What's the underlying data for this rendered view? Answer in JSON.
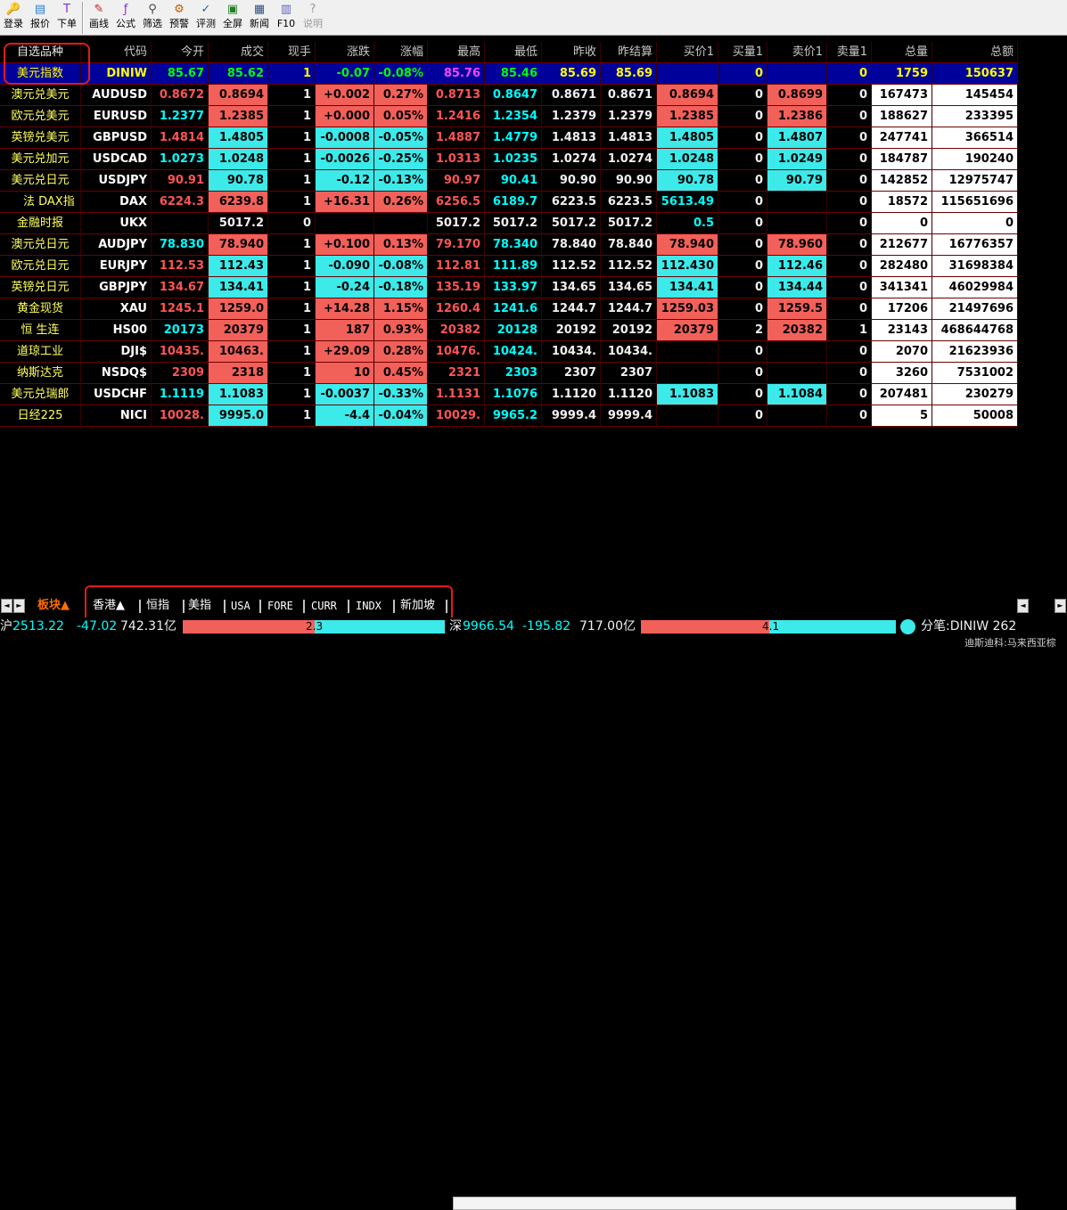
{
  "toolbar": {
    "items": [
      {
        "label": "登录",
        "icon": "login-icon",
        "glyph": "🔑"
      },
      {
        "label": "报价",
        "icon": "quote-icon",
        "glyph": "▤"
      },
      {
        "label": "下单",
        "icon": "order-icon",
        "glyph": "T"
      },
      {
        "label": "画线",
        "icon": "draw-line-icon",
        "glyph": "✎"
      },
      {
        "label": "公式",
        "icon": "formula-icon",
        "glyph": "ƒ"
      },
      {
        "label": "筛选",
        "icon": "filter-icon",
        "glyph": "⚲"
      },
      {
        "label": "预警",
        "icon": "alert-icon",
        "glyph": "⚙"
      },
      {
        "label": "评测",
        "icon": "evaluate-icon",
        "glyph": "✓"
      },
      {
        "label": "全屏",
        "icon": "fullscreen-icon",
        "glyph": "▣"
      },
      {
        "label": "新闻",
        "icon": "news-icon",
        "glyph": "▦"
      },
      {
        "label": "F10",
        "icon": "f10-icon",
        "glyph": "▥"
      },
      {
        "label": "说明",
        "icon": "help-icon",
        "glyph": "?"
      }
    ]
  },
  "table": {
    "headers": [
      "自选品种",
      "代码",
      "今开",
      "成交",
      "现手",
      "涨跌",
      "涨幅",
      "最高",
      "最低",
      "昨收",
      "昨结算",
      "买价1",
      "买量1",
      "卖价1",
      "卖量1",
      "总量",
      "总额"
    ],
    "rows": [
      {
        "name": "美元指数",
        "code": "DINIW",
        "open": "85.67",
        "last": "85.62",
        "vol_now": "1",
        "change": "-0.07",
        "pct": "-0.08%",
        "high": "85.76",
        "low": "85.46",
        "prev_close": "85.69",
        "prev_settle": "85.69",
        "bid": "",
        "bid_vol": "0",
        "ask": "",
        "ask_vol": "0",
        "total_vol": "1759",
        "amount": "150637"
      },
      {
        "name": "澳元兑美元",
        "code": "AUDUSD",
        "open": "0.8672",
        "last": "0.8694",
        "vol_now": "1",
        "change": "+0.002",
        "pct": "0.27%",
        "high": "0.8713",
        "low": "0.8647",
        "prev_close": "0.8671",
        "prev_settle": "0.8671",
        "bid": "0.8694",
        "bid_vol": "0",
        "ask": "0.8699",
        "ask_vol": "0",
        "total_vol": "167473",
        "amount": "145454"
      },
      {
        "name": "欧元兑美元",
        "code": "EURUSD",
        "open": "1.2377",
        "last": "1.2385",
        "vol_now": "1",
        "change": "+0.000",
        "pct": "0.05%",
        "high": "1.2416",
        "low": "1.2354",
        "prev_close": "1.2379",
        "prev_settle": "1.2379",
        "bid": "1.2385",
        "bid_vol": "0",
        "ask": "1.2386",
        "ask_vol": "0",
        "total_vol": "188627",
        "amount": "233395"
      },
      {
        "name": "英镑兑美元",
        "code": "GBPUSD",
        "open": "1.4814",
        "last": "1.4805",
        "vol_now": "1",
        "change": "-0.0008",
        "pct": "-0.05%",
        "high": "1.4887",
        "low": "1.4779",
        "prev_close": "1.4813",
        "prev_settle": "1.4813",
        "bid": "1.4805",
        "bid_vol": "0",
        "ask": "1.4807",
        "ask_vol": "0",
        "total_vol": "247741",
        "amount": "366514"
      },
      {
        "name": "美元兑加元",
        "code": "USDCAD",
        "open": "1.0273",
        "last": "1.0248",
        "vol_now": "1",
        "change": "-0.0026",
        "pct": "-0.25%",
        "high": "1.0313",
        "low": "1.0235",
        "prev_close": "1.0274",
        "prev_settle": "1.0274",
        "bid": "1.0248",
        "bid_vol": "0",
        "ask": "1.0249",
        "ask_vol": "0",
        "total_vol": "184787",
        "amount": "190240"
      },
      {
        "name": "美元兑日元",
        "code": "USDJPY",
        "open": "90.91",
        "last": "90.78",
        "vol_now": "1",
        "change": "-0.12",
        "pct": "-0.13%",
        "high": "90.97",
        "low": "90.41",
        "prev_close": "90.90",
        "prev_settle": "90.90",
        "bid": "90.78",
        "bid_vol": "0",
        "ask": "90.79",
        "ask_vol": "0",
        "total_vol": "142852",
        "amount": "12975747"
      },
      {
        "name": "法 DAX指",
        "code": "DAX",
        "open": "6224.3",
        "last": "6239.8",
        "vol_now": "1",
        "change": "+16.31",
        "pct": "0.26%",
        "high": "6256.5",
        "low": "6189.7",
        "prev_close": "6223.5",
        "prev_settle": "6223.5",
        "bid": "5613.49",
        "bid_vol": "0",
        "ask": "",
        "ask_vol": "0",
        "total_vol": "18572",
        "amount": "115651696"
      },
      {
        "name": "金融时报",
        "code": "UKX",
        "open": "",
        "last": "5017.2",
        "vol_now": "0",
        "change": "",
        "pct": "",
        "high": "5017.2",
        "low": "5017.2",
        "prev_close": "5017.2",
        "prev_settle": "5017.2",
        "bid": "0.5",
        "bid_vol": "0",
        "ask": "",
        "ask_vol": "0",
        "total_vol": "0",
        "amount": "0"
      },
      {
        "name": "澳元兑日元",
        "code": "AUDJPY",
        "open": "78.830",
        "last": "78.940",
        "vol_now": "1",
        "change": "+0.100",
        "pct": "0.13%",
        "high": "79.170",
        "low": "78.340",
        "prev_close": "78.840",
        "prev_settle": "78.840",
        "bid": "78.940",
        "bid_vol": "0",
        "ask": "78.960",
        "ask_vol": "0",
        "total_vol": "212677",
        "amount": "16776357"
      },
      {
        "name": "欧元兑日元",
        "code": "EURJPY",
        "open": "112.53",
        "last": "112.43",
        "vol_now": "1",
        "change": "-0.090",
        "pct": "-0.08%",
        "high": "112.81",
        "low": "111.89",
        "prev_close": "112.52",
        "prev_settle": "112.52",
        "bid": "112.430",
        "bid_vol": "0",
        "ask": "112.46",
        "ask_vol": "0",
        "total_vol": "282480",
        "amount": "31698384"
      },
      {
        "name": "英镑兑日元",
        "code": "GBPJPY",
        "open": "134.67",
        "last": "134.41",
        "vol_now": "1",
        "change": "-0.24",
        "pct": "-0.18%",
        "high": "135.19",
        "low": "133.97",
        "prev_close": "134.65",
        "prev_settle": "134.65",
        "bid": "134.41",
        "bid_vol": "0",
        "ask": "134.44",
        "ask_vol": "0",
        "total_vol": "341341",
        "amount": "46029984"
      },
      {
        "name": "黄金现货",
        "code": "XAU",
        "open": "1245.1",
        "last": "1259.0",
        "vol_now": "1",
        "change": "+14.28",
        "pct": "1.15%",
        "high": "1260.4",
        "low": "1241.6",
        "prev_close": "1244.7",
        "prev_settle": "1244.7",
        "bid": "1259.03",
        "bid_vol": "0",
        "ask": "1259.5",
        "ask_vol": "0",
        "total_vol": "17206",
        "amount": "21497696"
      },
      {
        "name": "恒 生连",
        "code": "HS00",
        "open": "20173",
        "last": "20379",
        "vol_now": "1",
        "change": "187",
        "pct": "0.93%",
        "high": "20382",
        "low": "20128",
        "prev_close": "20192",
        "prev_settle": "20192",
        "bid": "20379",
        "bid_vol": "2",
        "ask": "20382",
        "ask_vol": "1",
        "total_vol": "23143",
        "amount": "468644768"
      },
      {
        "name": "道琼工业",
        "code": "DJI$",
        "open": "10435.",
        "last": "10463.",
        "vol_now": "1",
        "change": "+29.09",
        "pct": "0.28%",
        "high": "10476.",
        "low": "10424.",
        "prev_close": "10434.",
        "prev_settle": "10434.",
        "bid": "",
        "bid_vol": "0",
        "ask": "",
        "ask_vol": "0",
        "total_vol": "2070",
        "amount": "21623936"
      },
      {
        "name": "纳斯达克",
        "code": "NSDQ$",
        "open": "2309",
        "last": "2318",
        "vol_now": "1",
        "change": "10",
        "pct": "0.45%",
        "high": "2321",
        "low": "2303",
        "prev_close": "2307",
        "prev_settle": "2307",
        "bid": "",
        "bid_vol": "0",
        "ask": "",
        "ask_vol": "0",
        "total_vol": "3260",
        "amount": "7531002"
      },
      {
        "name": "美元兑瑞郎",
        "code": "USDCHF",
        "open": "1.1119",
        "last": "1.1083",
        "vol_now": "1",
        "change": "-0.0037",
        "pct": "-0.33%",
        "high": "1.1131",
        "low": "1.1076",
        "prev_close": "1.1120",
        "prev_settle": "1.1120",
        "bid": "1.1083",
        "bid_vol": "0",
        "ask": "1.1084",
        "ask_vol": "0",
        "total_vol": "207481",
        "amount": "230279"
      },
      {
        "name": "日经225",
        "code": "NICI",
        "open": "10028.",
        "last": "9995.0",
        "vol_now": "1",
        "change": "-4.4",
        "pct": "-0.04%",
        "high": "10029.",
        "low": "9965.2",
        "prev_close": "9999.4",
        "prev_settle": "9999.4",
        "bid": "",
        "bid_vol": "0",
        "ask": "",
        "ask_vol": "0",
        "total_vol": "5",
        "amount": "50008"
      }
    ]
  },
  "tabs": {
    "scroll_left": "◄",
    "scroll_right": "►",
    "items": [
      "板块▲",
      "香港▲",
      "恒指",
      "美指",
      "USA",
      "FORE",
      "CURR",
      "INDX",
      "新加坡"
    ]
  },
  "status": {
    "sh_label": "沪",
    "sh_index": "2513.22",
    "sh_change": "-47.02",
    "sh_amount": "742.31亿",
    "sh_ratio": "2.3",
    "sz_label": "深",
    "sz_index": "9966.54",
    "sz_change": "-195.82",
    "sz_amount": "717.00亿",
    "sz_ratio": "4.1",
    "tick": "分笔:DINIW 262",
    "ticker": "迪斯迪科:马来西亚棕"
  },
  "colors": {
    "up_red": "#ff5555",
    "down_cyan": "#00ffff",
    "cell_red_bg": "#f2605a",
    "cell_cyan_bg": "#3ceaea",
    "highlight_row_bg": "#00009a",
    "grid_line": "#6e0000",
    "annotation_red": "#e21b1b"
  }
}
